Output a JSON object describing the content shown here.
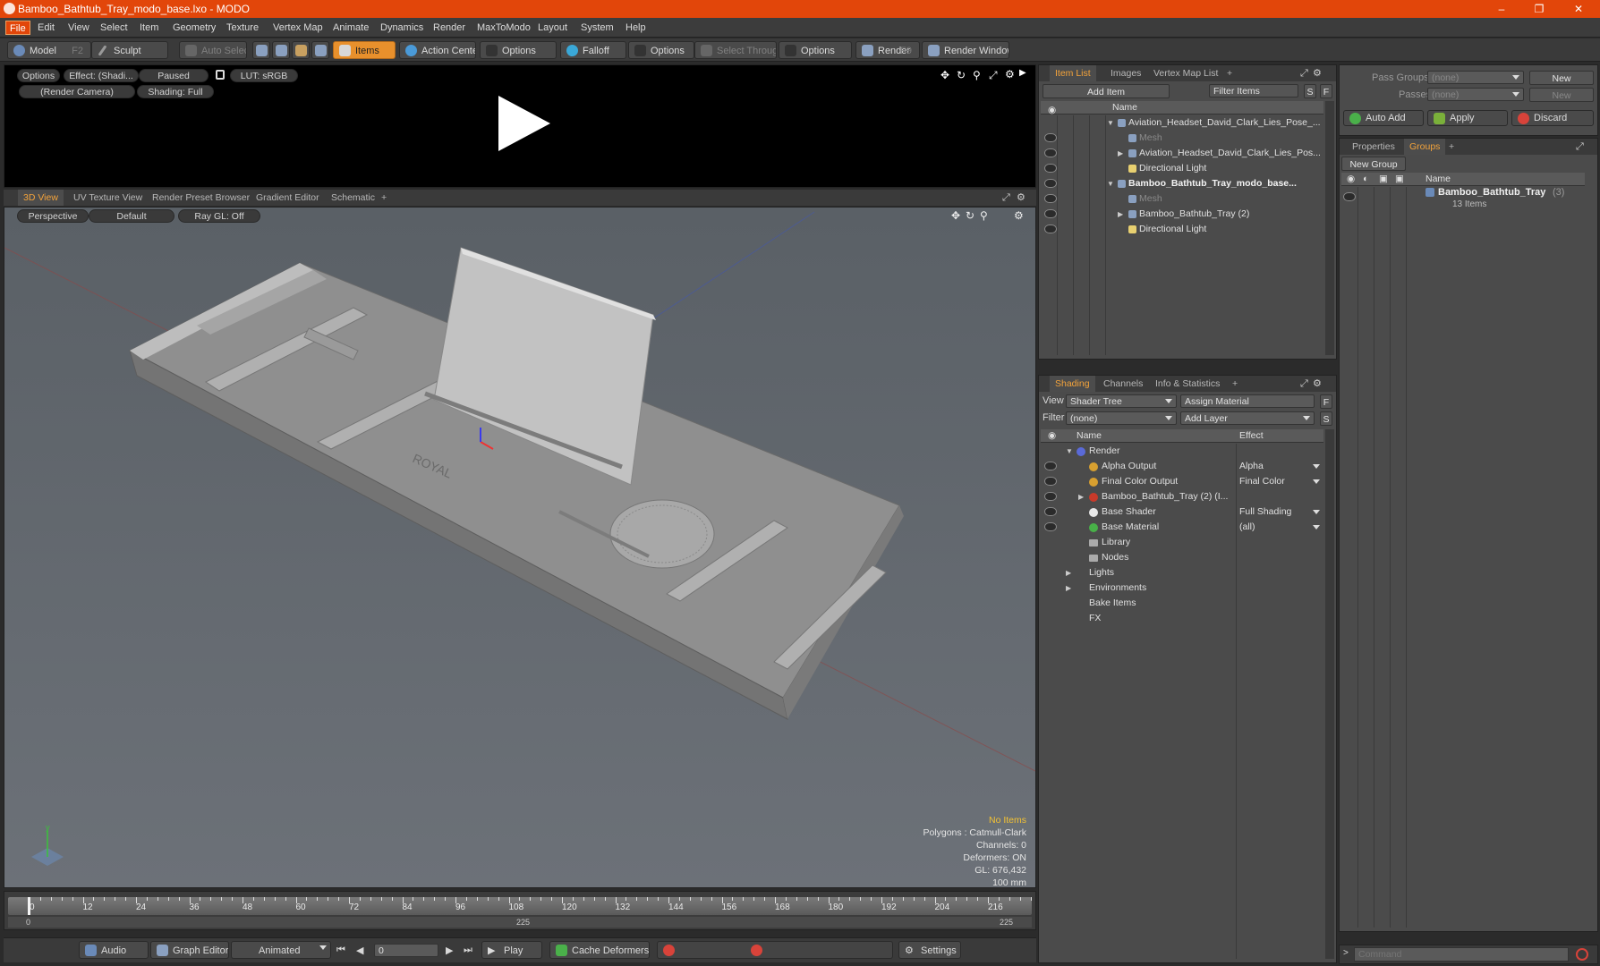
{
  "window": {
    "title": "Bamboo_Bathtub_Tray_modo_base.lxo - MODO",
    "min": "–",
    "max": "❐",
    "close": "✕"
  },
  "menus": [
    "File",
    "Edit",
    "View",
    "Select",
    "Item",
    "Geometry",
    "Texture",
    "Vertex Map",
    "Animate",
    "Dynamics",
    "Render",
    "MaxToModo",
    "Layout",
    "System",
    "Help"
  ],
  "toolbar": {
    "model": "Model",
    "model_key": "F2",
    "sculpt": "Sculpt",
    "auto_select": "Auto Select",
    "items": "Items",
    "action_center": "Action Center",
    "options1": "Options",
    "falloff": "Falloff",
    "options2": "Options",
    "select_through": "Select Through",
    "options3": "Options",
    "render": "Render",
    "render_key": "F9",
    "render_window": "Render Window"
  },
  "preview": {
    "options": "Options",
    "effect": "Effect: (Shadi...",
    "paused": "Paused",
    "lut": "LUT: sRGB",
    "camera": "(Render Camera)",
    "shading": "Shading: Full"
  },
  "viewtabs": [
    "3D View",
    "UV Texture View",
    "Render Preset Browser",
    "Gradient Editor",
    "Schematic",
    "+"
  ],
  "viewport": {
    "perspective": "Perspective",
    "default": "Default",
    "raygl": "Ray GL: Off",
    "model_label": "ROYAL",
    "status": {
      "no_items": "No Items",
      "polygons": "Polygons : Catmull-Clark",
      "channels": "Channels: 0",
      "deformers": "Deformers: ON",
      "gl": "GL: 676,432",
      "scale": "100 mm"
    }
  },
  "timeline": {
    "ticks": [
      "0",
      "12",
      "24",
      "36",
      "48",
      "60",
      "72",
      "84",
      "96",
      "108",
      "120",
      "132",
      "144",
      "156",
      "168",
      "180",
      "192",
      "204",
      "216"
    ],
    "lower": [
      "0",
      "225",
      "225"
    ]
  },
  "bottombar": {
    "audio": "Audio",
    "graph_editor": "Graph Editor",
    "animated": "Animated",
    "frame": "0",
    "play": "Play",
    "cache_deformers": "Cache Deformers",
    "settings": "Settings"
  },
  "itemlist": {
    "tabs": [
      "Item List",
      "Images",
      "Vertex Map List",
      "+"
    ],
    "add_item": "Add Item",
    "filter": "Filter Items",
    "s": "S",
    "f": "F",
    "col_name": "Name",
    "rows": [
      {
        "label": "Aviation_Headset_David_Clark_Lies_Pose_...",
        "indent": 0,
        "arrow": "▼",
        "dim": false,
        "bold": false,
        "eye": false
      },
      {
        "label": "Mesh",
        "indent": 1,
        "arrow": "",
        "dim": true,
        "bold": false,
        "eye": true
      },
      {
        "label": "Aviation_Headset_David_Clark_Lies_Pos...",
        "indent": 1,
        "arrow": "▶",
        "dim": false,
        "bold": false,
        "eye": true
      },
      {
        "label": "Directional Light",
        "indent": 1,
        "arrow": "",
        "dim": false,
        "bold": false,
        "eye": true
      },
      {
        "label": "Bamboo_Bathtub_Tray_modo_base...",
        "indent": 0,
        "arrow": "▼",
        "dim": false,
        "bold": true,
        "eye": true
      },
      {
        "label": "Mesh",
        "indent": 1,
        "arrow": "",
        "dim": true,
        "bold": false,
        "eye": true
      },
      {
        "label": "Bamboo_Bathtub_Tray (2)",
        "indent": 1,
        "arrow": "▶",
        "dim": false,
        "bold": false,
        "eye": true
      },
      {
        "label": "Directional Light",
        "indent": 1,
        "arrow": "",
        "dim": false,
        "bold": false,
        "eye": true
      }
    ]
  },
  "shading": {
    "tabs": [
      "Shading",
      "Channels",
      "Info & Statistics",
      "+"
    ],
    "view_label": "View",
    "view_value": "Shader Tree",
    "assign": "Assign Material",
    "f": "F",
    "filter_label": "Filter",
    "filter_value": "(none)",
    "add_layer": "Add Layer",
    "s": "S",
    "col_name": "Name",
    "col_effect": "Effect",
    "rows": [
      {
        "label": "Render",
        "effect": "",
        "indent": 0,
        "arrow": "▼",
        "color": "#5a6ad8",
        "eye": false
      },
      {
        "label": "Alpha Output",
        "effect": "Alpha",
        "indent": 1,
        "arrow": "",
        "color": "#d8a030",
        "eye": true
      },
      {
        "label": "Final Color Output",
        "effect": "Final Color",
        "indent": 1,
        "arrow": "",
        "color": "#d8a030",
        "eye": true
      },
      {
        "label": "Bamboo_Bathtub_Tray (2) (I...",
        "effect": "",
        "indent": 1,
        "arrow": "▶",
        "color": "#c83a2a",
        "eye": true
      },
      {
        "label": "Base Shader",
        "effect": "Full Shading",
        "indent": 1,
        "arrow": "",
        "color": "#e8e8e8",
        "eye": true
      },
      {
        "label": "Base Material",
        "effect": "(all)",
        "indent": 1,
        "arrow": "",
        "color": "#48b048",
        "eye": true
      },
      {
        "label": "Library",
        "effect": "",
        "indent": 1,
        "arrow": "",
        "color": "",
        "eye": false
      },
      {
        "label": "Nodes",
        "effect": "",
        "indent": 1,
        "arrow": "",
        "color": "",
        "eye": false
      },
      {
        "label": "Lights",
        "effect": "",
        "indent": 0,
        "arrow": "▶",
        "color": "",
        "eye": false
      },
      {
        "label": "Environments",
        "effect": "",
        "indent": 0,
        "arrow": "▶",
        "color": "",
        "eye": false
      },
      {
        "label": "Bake Items",
        "effect": "",
        "indent": 0,
        "arrow": "",
        "color": "",
        "eye": false
      },
      {
        "label": "FX",
        "effect": "",
        "indent": 0,
        "arrow": "",
        "color": "",
        "eye": false
      }
    ]
  },
  "passes": {
    "pass_groups": "Pass Groups",
    "pass_value": "(none)",
    "new": "New",
    "passes": "Passes",
    "passes_value": "(none)",
    "new2": "New",
    "auto_add": "Auto Add",
    "apply": "Apply",
    "discard": "Discard"
  },
  "groups": {
    "tabs": [
      "Properties",
      "Groups",
      "+"
    ],
    "new_group": "New Group",
    "col_name": "Name",
    "item": "Bamboo_Bathtub_Tray",
    "item_count": "(3)",
    "sub": "13 Items"
  },
  "command": {
    "placeholder": "Command"
  }
}
